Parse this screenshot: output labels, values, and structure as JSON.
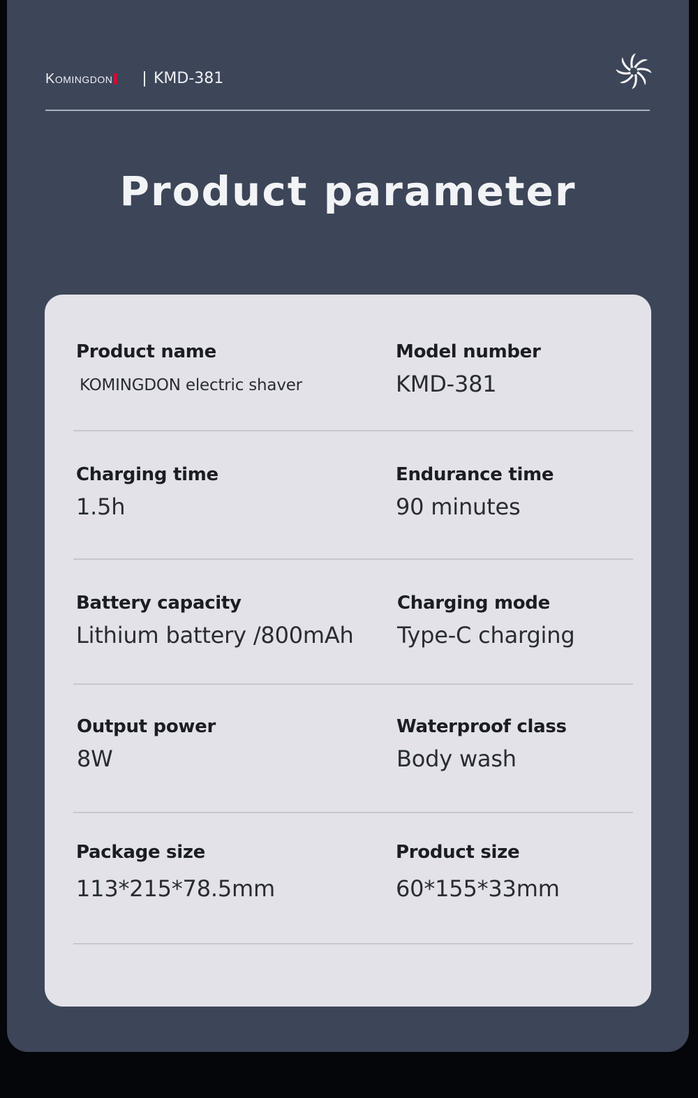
{
  "header": {
    "brand": "Komingdon",
    "model": "KMD-381",
    "logo_icon": "pinwheel-icon"
  },
  "title": "Product parameter",
  "params": [
    {
      "label": "Product name",
      "value": "KOMINGDON electric shaver"
    },
    {
      "label": "Model number",
      "value": "KMD-381"
    },
    {
      "label": "Charging time",
      "value": "1.5h"
    },
    {
      "label": "Endurance time",
      "value": "90 minutes"
    },
    {
      "label": "Battery capacity",
      "value": "Lithium battery /800mAh"
    },
    {
      "label": "Charging mode",
      "value": "Type-C charging"
    },
    {
      "label": "Output power",
      "value": "8W"
    },
    {
      "label": "Waterproof class",
      "value": "Body wash"
    },
    {
      "label": "Package size",
      "value": "113*215*78.5mm"
    },
    {
      "label": "Product size",
      "value": "60*155*33mm"
    }
  ],
  "colors": {
    "panel": "#3d4558",
    "card": "#e2e2e8",
    "brand_accent": "#c8102e"
  }
}
